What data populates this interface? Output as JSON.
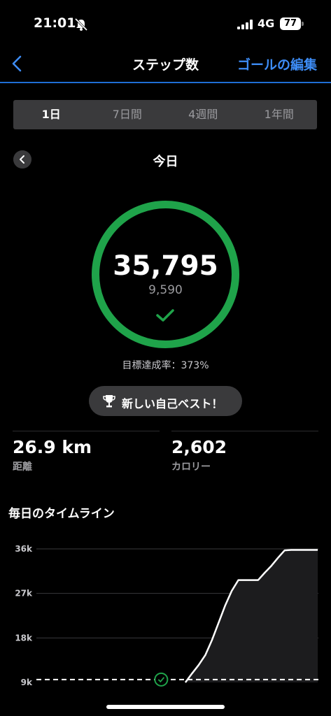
{
  "status_bar": {
    "time": "21:01",
    "network": "4G",
    "battery": "77",
    "icons": [
      "silent-mode-bell-icon",
      "signal-bars-icon",
      "battery-icon"
    ]
  },
  "nav": {
    "title": "ステップ数",
    "edit_goal": "ゴールの編集",
    "back_icon": "chevron-left-icon"
  },
  "segments": {
    "items": [
      "1日",
      "7日間",
      "4週間",
      "1年間"
    ],
    "selected": "1日"
  },
  "day": {
    "label": "今日",
    "prev_icon": "chevron-left-icon"
  },
  "summary": {
    "steps": "35,795",
    "goal": "9,590",
    "rate": "目標達成率：373%",
    "ring_color": "#1fa34a"
  },
  "best": {
    "label": "新しい自己ベスト！",
    "icon": "trophy-icon"
  },
  "stats": {
    "distance": {
      "value": "26.9 km",
      "label": "距離"
    },
    "calories": {
      "value": "2,602",
      "label": "カロリー"
    }
  },
  "timeline": {
    "title": "毎日のタイムライン"
  },
  "chart_data": {
    "type": "area",
    "title": "",
    "y_ticks": [
      "36k",
      "27k",
      "18k",
      "9k"
    ],
    "ylim": [
      9000,
      36000
    ],
    "goal_line": 9590,
    "goal_marker_icon": "goal-check-icon",
    "x": [
      0.56,
      0.58,
      0.6,
      0.62,
      0.64,
      0.66,
      0.68,
      0.7,
      0.72,
      0.74,
      0.76,
      0.78,
      0.8,
      0.82,
      0.84,
      0.86,
      0.88,
      0.9,
      0.92,
      0.94,
      0.96
    ],
    "series": [
      {
        "values": [
          9000,
          10800,
          12500,
          14500,
          17500,
          21000,
          24500,
          27500,
          29700,
          29700,
          29700,
          29700,
          31200,
          32600,
          34200,
          35700,
          35795,
          35795,
          35795,
          35795,
          35795
        ]
      }
    ],
    "line_color": "#ffffff",
    "fill_color": "#1c1c1e",
    "grid": true
  }
}
